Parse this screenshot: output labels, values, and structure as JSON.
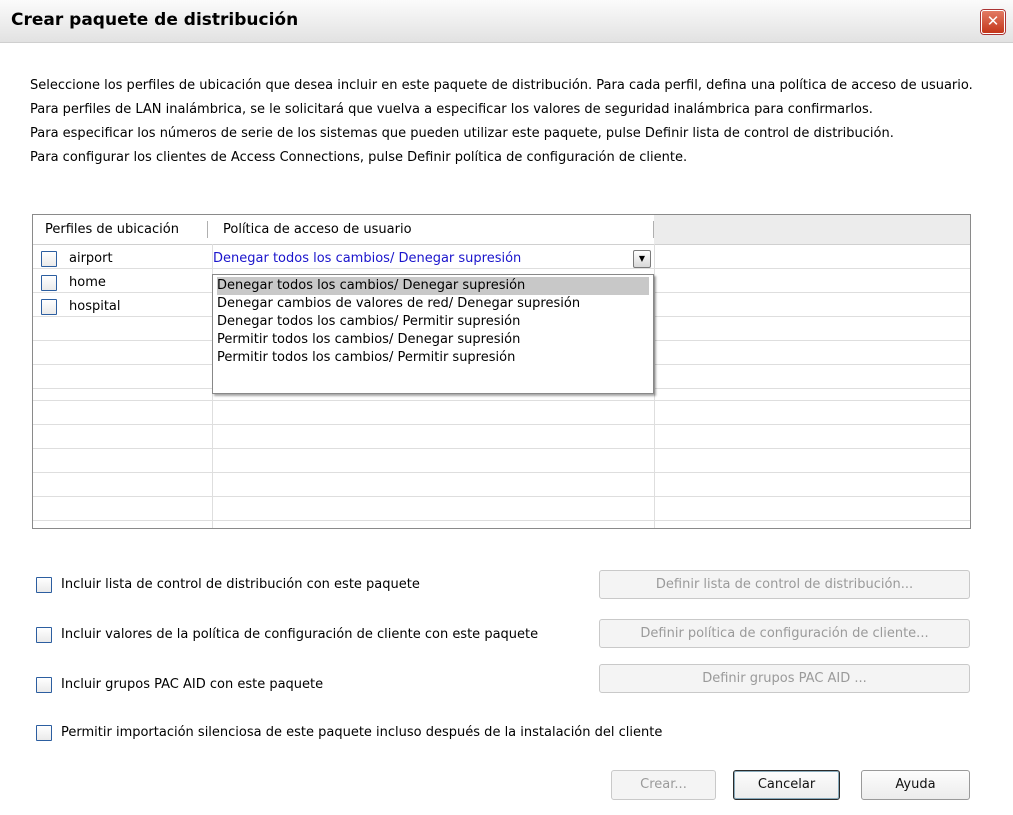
{
  "window": {
    "title": "Crear paquete de distribución",
    "close_icon": "close-icon"
  },
  "intro": [
    "Seleccione los perfiles de ubicación que desea incluir en este paquete de distribución. Para cada perfil, defina una política de acceso de usuario.",
    "Para perfiles de LAN inalámbrica, se le solicitará que vuelva a especificar los valores de seguridad inalámbrica para confirmarlos.",
    "Para especificar los números de serie de los sistemas que pueden utilizar este paquete, pulse Definir lista de control de distribución.",
    "Para configurar los clientes de Access Connections, pulse Definir política de configuración de cliente."
  ],
  "grid": {
    "headers": [
      "Perfiles de ubicación",
      "Política de acceso de usuario"
    ],
    "profiles": [
      "airport",
      "home",
      "hospital"
    ],
    "policy_value": "Denegar todos los cambios/ Denegar supresión",
    "dropdown_options": [
      "Denegar todos los cambios/ Denegar supresión",
      "Denegar cambios de valores de red/ Denegar supresión",
      "Denegar todos los cambios/ Permitir supresión",
      "Permitir todos los cambios/ Denegar supresión",
      "Permitir todos los cambios/ Permitir supresión"
    ]
  },
  "options": {
    "include_acl": "Incluir lista de control de distribución con este paquete",
    "include_policy": "Incluir valores de la política de configuración de cliente con este paquete",
    "include_pac": "Incluir grupos PAC AID con este paquete",
    "silent_import": "Permitir importación silenciosa de este paquete incluso después de la instalación del cliente"
  },
  "buttons": {
    "define_acl": "Definir lista de control de distribución...",
    "define_policy": "Definir política de configuración de cliente...",
    "define_pac": "Definir grupos PAC AID ...",
    "create": "Crear...",
    "cancel": "Cancelar",
    "help": "Ayuda"
  },
  "colors": {
    "link_blue": "#1a14cc",
    "close_red": "#c4361a"
  }
}
